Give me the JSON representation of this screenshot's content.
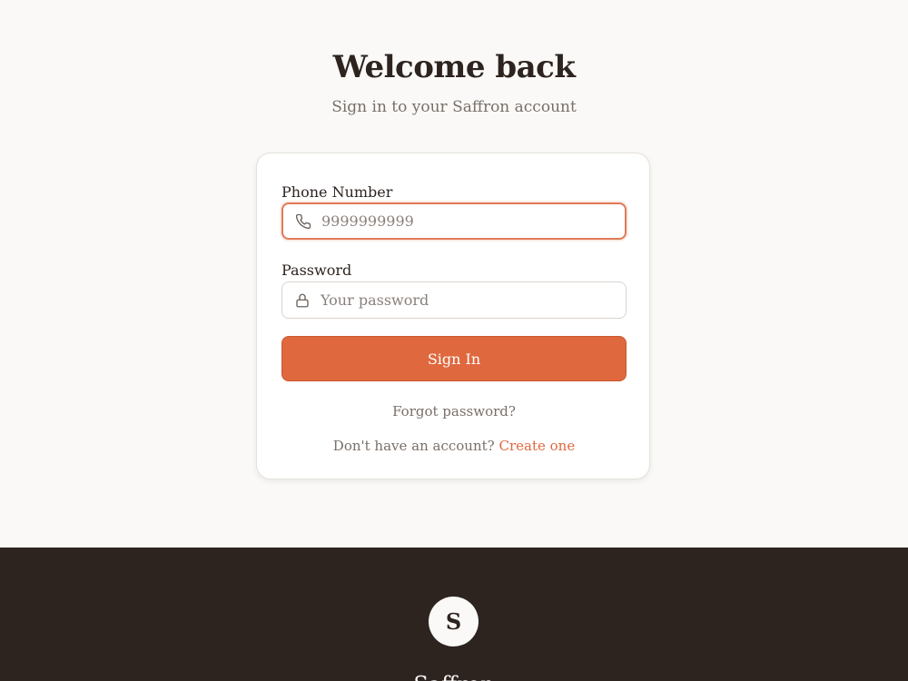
{
  "header": {
    "title": "Welcome back",
    "subtitle": "Sign in to your Saffron account"
  },
  "form": {
    "phone": {
      "label": "Phone Number",
      "placeholder": "9999999999",
      "value": "",
      "icon": "phone-icon"
    },
    "password": {
      "label": "Password",
      "placeholder": "Your password",
      "value": "",
      "icon": "lock-icon"
    },
    "submit_label": "Sign In",
    "forgot_label": "Forgot password?",
    "no_account_text": "Don't have an account?",
    "create_link": "Create one"
  },
  "footer": {
    "logo_letter": "S",
    "brand_name": "Saffron"
  },
  "colors": {
    "accent": "#df683f",
    "background": "#faf9f7",
    "footer_bg": "#2d2420",
    "text_primary": "#2d2420",
    "text_muted": "#7a6f68"
  }
}
